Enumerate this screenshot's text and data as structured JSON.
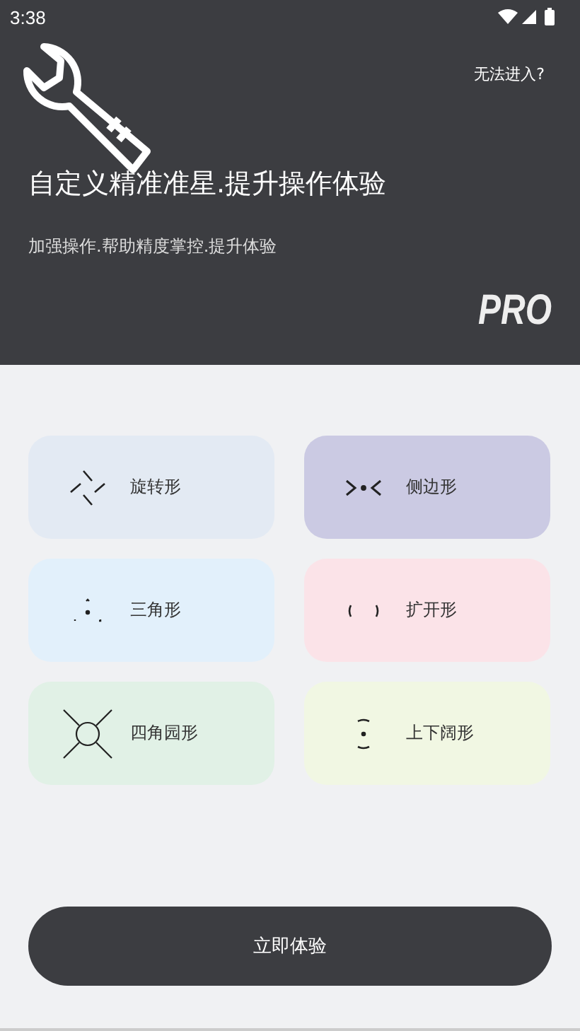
{
  "status_bar": {
    "time": "3:38"
  },
  "header": {
    "help_link": "无法进入?",
    "title": "自定义精准准星.提升操作体验",
    "subtitle": "加强操作.帮助精度掌控.提升体验",
    "badge": "PRO"
  },
  "styles": [
    {
      "kind": "rotate",
      "label": "旋转形",
      "color": "#e3eaf3"
    },
    {
      "kind": "side",
      "label": "侧边形",
      "color": "#cbcae3"
    },
    {
      "kind": "triangle",
      "label": "三角形",
      "color": "#e2f0fb"
    },
    {
      "kind": "expand",
      "label": "扩开形",
      "color": "#fbe3e8"
    },
    {
      "kind": "circle",
      "label": "四角园形",
      "color": "#e1f1e6"
    },
    {
      "kind": "vertical",
      "label": "上下阔形",
      "color": "#f1f7e3"
    }
  ],
  "action_button": "立即体验"
}
